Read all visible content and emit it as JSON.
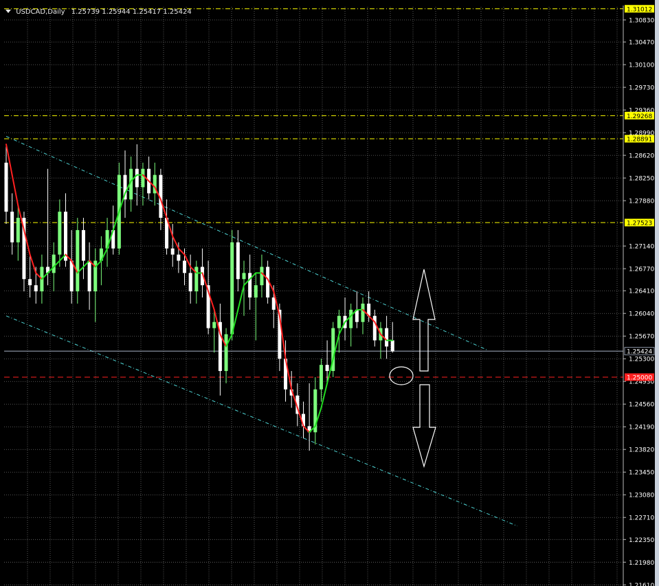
{
  "window": {
    "symbol": "USDCAD,Daily",
    "ohlc": "1.25739 1.25944 1.25417 1.25424"
  },
  "colors": {
    "background": "#000000",
    "grid": "#6f6f6f",
    "bull": "#7dff7d",
    "bear": "#ffffff",
    "ma_up": "#22dd22",
    "ma_down": "#ff2020",
    "level": "#ffff00",
    "support": "#ff2020",
    "channel": "#4fd6d6",
    "price_line": "#a9b4c8",
    "arrow": "#ffffff"
  },
  "chart_data": {
    "type": "candlestick",
    "ylim": [
      1.214,
      1.312
    ],
    "y_ticks": [
      "1.30830",
      "1.30470",
      "1.30100",
      "1.29730",
      "1.29360",
      "1.28990",
      "1.28620",
      "1.28250",
      "1.27880",
      "1.27140",
      "1.26770",
      "1.26410",
      "1.26040",
      "1.25670",
      "1.25300",
      "1.24930",
      "1.24560",
      "1.24190",
      "1.23820",
      "1.23450",
      "1.23080",
      "1.22710",
      "1.22350",
      "1.21980",
      "1.21610"
    ],
    "levels": [
      {
        "value": 1.31012,
        "label": "1.31012",
        "style": "dash-dot",
        "color": "#ffff00"
      },
      {
        "value": 1.29268,
        "label": "1.29268",
        "style": "dash-dot",
        "color": "#ffff00"
      },
      {
        "value": 1.28891,
        "label": "1.28891",
        "style": "dash-dot",
        "color": "#ffff00"
      },
      {
        "value": 1.27523,
        "label": "1.27523",
        "style": "dash-dot",
        "color": "#ffff00"
      },
      {
        "value": 1.25424,
        "label": "1.25424",
        "style": "solid",
        "color": "#a9b4c8"
      },
      {
        "value": 1.25,
        "label": "1.25000",
        "style": "dash",
        "color": "#ff2020"
      }
    ],
    "ohlc": [
      [
        1.285,
        1.288,
        1.275,
        1.277
      ],
      [
        1.277,
        1.28,
        1.27,
        1.272
      ],
      [
        1.272,
        1.278,
        1.269,
        1.276
      ],
      [
        1.276,
        1.277,
        1.264,
        1.266
      ],
      [
        1.266,
        1.27,
        1.263,
        1.265
      ],
      [
        1.265,
        1.268,
        1.262,
        1.264
      ],
      [
        1.264,
        1.27,
        1.262,
        1.268
      ],
      [
        1.268,
        1.284,
        1.265,
        1.267
      ],
      [
        1.267,
        1.272,
        1.264,
        1.27
      ],
      [
        1.27,
        1.279,
        1.268,
        1.277
      ],
      [
        1.277,
        1.28,
        1.268,
        1.269
      ],
      [
        1.269,
        1.274,
        1.262,
        1.264
      ],
      [
        1.264,
        1.276,
        1.262,
        1.274
      ],
      [
        1.274,
        1.276,
        1.266,
        1.269
      ],
      [
        1.269,
        1.272,
        1.261,
        1.264
      ],
      [
        1.264,
        1.271,
        1.259,
        1.269
      ],
      [
        1.269,
        1.273,
        1.265,
        1.271
      ],
      [
        1.271,
        1.276,
        1.268,
        1.274
      ],
      [
        1.274,
        1.278,
        1.27,
        1.271
      ],
      [
        1.271,
        1.285,
        1.27,
        1.283
      ],
      [
        1.283,
        1.287,
        1.276,
        1.279
      ],
      [
        1.279,
        1.286,
        1.277,
        1.284
      ],
      [
        1.284,
        1.288,
        1.278,
        1.281
      ],
      [
        1.281,
        1.285,
        1.278,
        1.284
      ],
      [
        1.284,
        1.286,
        1.279,
        1.28
      ],
      [
        1.28,
        1.285,
        1.278,
        1.283
      ],
      [
        1.283,
        1.284,
        1.274,
        1.276
      ],
      [
        1.276,
        1.279,
        1.27,
        1.271
      ],
      [
        1.271,
        1.275,
        1.268,
        1.27
      ],
      [
        1.27,
        1.272,
        1.267,
        1.269
      ],
      [
        1.269,
        1.271,
        1.265,
        1.267
      ],
      [
        1.267,
        1.27,
        1.262,
        1.264
      ],
      [
        1.264,
        1.269,
        1.262,
        1.268
      ],
      [
        1.268,
        1.271,
        1.263,
        1.265
      ],
      [
        1.265,
        1.269,
        1.257,
        1.258
      ],
      [
        1.258,
        1.261,
        1.254,
        1.259
      ],
      [
        1.259,
        1.262,
        1.247,
        1.251
      ],
      [
        1.251,
        1.258,
        1.249,
        1.257
      ],
      [
        1.257,
        1.274,
        1.256,
        1.272
      ],
      [
        1.272,
        1.274,
        1.264,
        1.266
      ],
      [
        1.266,
        1.269,
        1.26,
        1.267
      ],
      [
        1.267,
        1.27,
        1.261,
        1.263
      ],
      [
        1.263,
        1.267,
        1.256,
        1.265
      ],
      [
        1.265,
        1.27,
        1.263,
        1.268
      ],
      [
        1.268,
        1.269,
        1.262,
        1.263
      ],
      [
        1.263,
        1.265,
        1.258,
        1.261
      ],
      [
        1.261,
        1.262,
        1.251,
        1.253
      ],
      [
        1.253,
        1.256,
        1.246,
        1.248
      ],
      [
        1.248,
        1.251,
        1.245,
        1.247
      ],
      [
        1.247,
        1.249,
        1.242,
        1.244
      ],
      [
        1.244,
        1.246,
        1.24,
        1.242
      ],
      [
        1.242,
        1.249,
        1.238,
        1.241
      ],
      [
        1.241,
        1.25,
        1.239,
        1.248
      ],
      [
        1.248,
        1.253,
        1.246,
        1.252
      ],
      [
        1.252,
        1.256,
        1.249,
        1.251
      ],
      [
        1.251,
        1.259,
        1.25,
        1.258
      ],
      [
        1.258,
        1.261,
        1.254,
        1.26
      ],
      [
        1.26,
        1.263,
        1.256,
        1.258
      ],
      [
        1.258,
        1.262,
        1.255,
        1.261
      ],
      [
        1.261,
        1.264,
        1.258,
        1.259
      ],
      [
        1.259,
        1.263,
        1.257,
        1.262
      ],
      [
        1.262,
        1.264,
        1.259,
        1.26
      ],
      [
        1.26,
        1.261,
        1.255,
        1.256
      ],
      [
        1.256,
        1.259,
        1.253,
        1.258
      ],
      [
        1.258,
        1.26,
        1.253,
        1.255
      ],
      [
        1.256,
        1.259,
        1.254,
        1.2542
      ]
    ],
    "ma": [
      1.288,
      1.283,
      1.278,
      1.274,
      1.27,
      1.267,
      1.266,
      1.267,
      1.268,
      1.269,
      1.27,
      1.269,
      1.267,
      1.268,
      1.269,
      1.268,
      1.269,
      1.271,
      1.274,
      1.277,
      1.28,
      1.282,
      1.283,
      1.283,
      1.282,
      1.281,
      1.279,
      1.276,
      1.273,
      1.271,
      1.27,
      1.268,
      1.267,
      1.267,
      1.264,
      1.261,
      1.257,
      1.255,
      1.257,
      1.261,
      1.265,
      1.266,
      1.267,
      1.267,
      1.266,
      1.264,
      1.26,
      1.253,
      1.248,
      1.245,
      1.242,
      1.241,
      1.242,
      1.245,
      1.249,
      1.253,
      1.257,
      1.259,
      1.26,
      1.261,
      1.261,
      1.26,
      1.259,
      1.257,
      1.256,
      1.256
    ],
    "channel": {
      "upper": [
        [
          0,
          1.2893
        ],
        [
          81,
          1.2544
        ]
      ],
      "lower": [
        [
          0,
          1.26
        ],
        [
          86,
          1.2257
        ]
      ]
    }
  }
}
